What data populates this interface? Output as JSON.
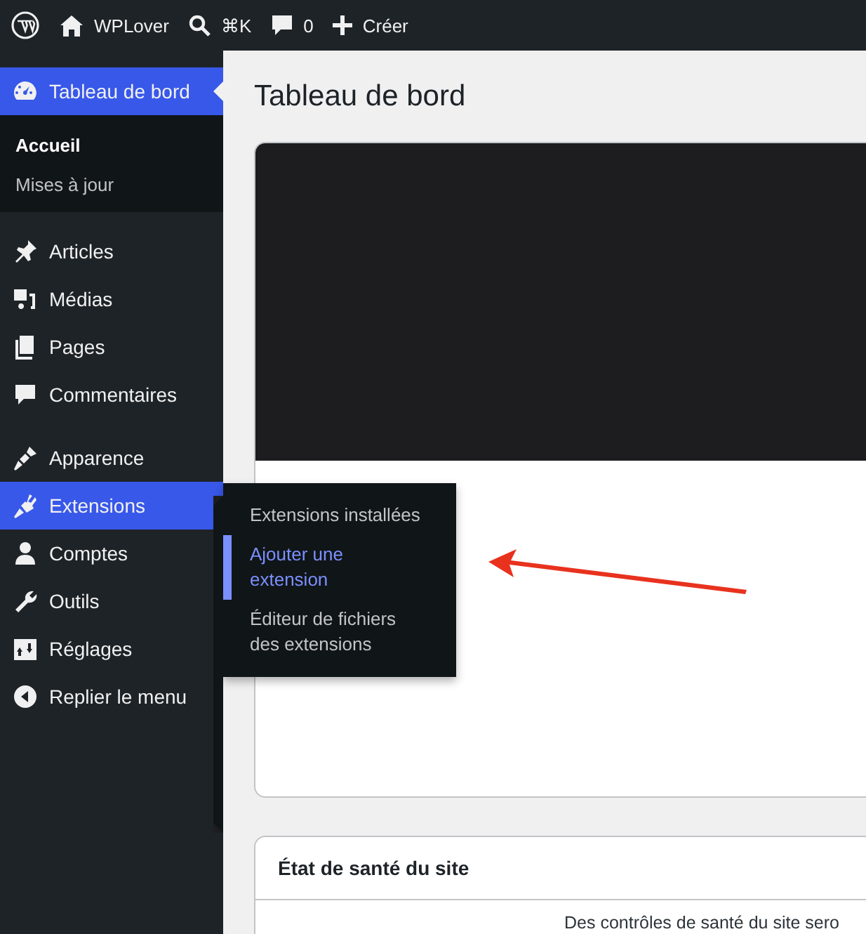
{
  "admin_bar": {
    "site_name": "WPLover",
    "shortcut": "⌘K",
    "comments": "0",
    "new_label": "Créer"
  },
  "sidebar": {
    "sections": [
      {
        "items": [
          {
            "label": "Tableau de bord",
            "selected": true,
            "submenu": [
              {
                "label": "Accueil",
                "selected": true
              },
              {
                "label": "Mises à jour",
                "selected": false
              }
            ]
          }
        ]
      },
      {
        "items": [
          {
            "label": "Articles",
            "selected": false
          },
          {
            "label": "Médias",
            "selected": false
          },
          {
            "label": "Pages",
            "selected": false
          },
          {
            "label": "Commentaires",
            "selected": false
          }
        ]
      },
      {
        "items": [
          {
            "label": "Apparence",
            "selected": false
          },
          {
            "label": "Extensions",
            "selected": true,
            "flyout": [
              {
                "label": "Extensions installées",
                "selected": false
              },
              {
                "label": "Ajouter une extension",
                "selected": true
              },
              {
                "label": "Éditeur de fichiers des extensions",
                "selected": false
              }
            ]
          },
          {
            "label": "Comptes",
            "selected": false
          },
          {
            "label": "Outils",
            "selected": false
          },
          {
            "label": "Réglages",
            "selected": false
          },
          {
            "label": "Replier le menu",
            "selected": false
          }
        ]
      }
    ]
  },
  "main": {
    "title": "Tableau de bord",
    "site_health": {
      "title": "État de santé du site",
      "text": "Des contrôles de santé du site sero"
    }
  }
}
